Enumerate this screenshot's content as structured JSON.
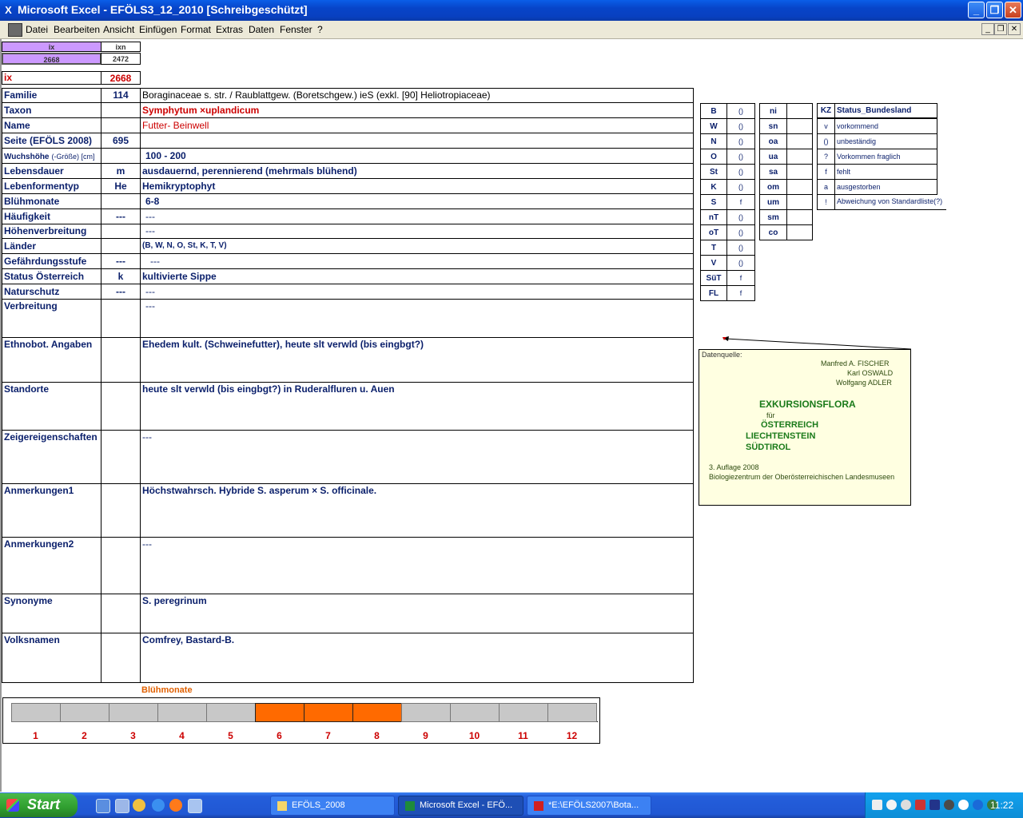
{
  "window": {
    "title": "Microsoft Excel - EFÖLS3_12_2010  [Schreibgeschützt]",
    "app_icon": "X",
    "min_label": "_",
    "max_label": "❐",
    "close_label": "✕"
  },
  "menu": [
    "Datei",
    "Bearbeiten",
    "Ansicht",
    "Einfügen",
    "Format",
    "Extras",
    "Daten",
    "Fenster",
    "?"
  ],
  "index": {
    "ix_header": "ix",
    "ixn_header": "ixn",
    "ix_value": "2668",
    "ixn_value": "2472",
    "ix_label": "ix",
    "ix_value2": "2668"
  },
  "rows": [
    {
      "label": "Familie",
      "code": "114",
      "value": "Boraginaceae s. str.  /  Raublattgew. (Boretschgew.) ieS (exkl. [90] Heliotropiaceae)"
    },
    {
      "label": "Taxon",
      "code": "",
      "value": "Symphytum ×uplandicum"
    },
    {
      "label": "Name",
      "code": "",
      "value": "Futter- Beinwell"
    },
    {
      "label": "Seite (EFÖLS 2008)",
      "code": "695",
      "value": ""
    },
    {
      "label": "Wuchshöhe",
      "label_suffix": "(-Größe) [cm]",
      "code": "",
      "value": "100 - 200"
    },
    {
      "label": "Lebensdauer",
      "code": "m",
      "value": "ausdauernd, perennierend (mehrmals blühend)"
    },
    {
      "label": "Lebenformentyp",
      "code": "He",
      "value": "Hemikryptophyt"
    },
    {
      "label": "Blühmonate",
      "code": "",
      "value": "6-8"
    },
    {
      "label": "Häufigkeit",
      "code": "---",
      "value": "---"
    },
    {
      "label": "Höhenverbreitung",
      "code": "",
      "value": "---"
    },
    {
      "label": "Länder",
      "code": "",
      "value": "(B, W, N, O, St, K, T, V)"
    },
    {
      "label": "Gefährdungsstufe",
      "code": "---",
      "value": "---"
    },
    {
      "label": "Status Österreich",
      "code": "k",
      "value": "kultivierte Sippe"
    },
    {
      "label": "Naturschutz",
      "code": "---",
      "value": "---"
    },
    {
      "label": "Verbreitung",
      "code": "",
      "value": "---"
    },
    {
      "label": "Ethnobot. Angaben",
      "code": "",
      "value": "Ehedem kult. (Schweinefutter), heute slt verwld (bis eingbgt?)"
    },
    {
      "label": "Standorte",
      "code": "",
      "value": "heute slt verwld (bis eingbgt?) in Ruderalfluren u. Auen"
    },
    {
      "label": "Zeigereigenschaften",
      "code": "",
      "value": "---"
    },
    {
      "label": "Anmerkungen1",
      "code": "",
      "value": "Höchstwahrsch. Hybride S. asperum × S. officinale."
    },
    {
      "label": "Anmerkungen2",
      "code": "",
      "value": "---"
    },
    {
      "label": "Synonyme",
      "code": "",
      "value": "S. peregrinum"
    },
    {
      "label": "Volksnamen",
      "code": "",
      "value": "Comfrey, Bastard-B."
    }
  ],
  "states": [
    {
      "code": "B",
      "status": "()"
    },
    {
      "code": "W",
      "status": "()"
    },
    {
      "code": "N",
      "status": "()"
    },
    {
      "code": "O",
      "status": "()"
    },
    {
      "code": "St",
      "status": "()"
    },
    {
      "code": "K",
      "status": "()"
    },
    {
      "code": "S",
      "status": "f"
    },
    {
      "code": "nT",
      "status": "()"
    },
    {
      "code": "oT",
      "status": "()"
    },
    {
      "code": "T",
      "status": "()"
    },
    {
      "code": "V",
      "status": "()"
    },
    {
      "code": "SüT",
      "status": "f"
    },
    {
      "code": "FL",
      "status": "f"
    }
  ],
  "altitudes": [
    "ni",
    "sn",
    "oa",
    "ua",
    "sa",
    "om",
    "um",
    "sm",
    "co"
  ],
  "legend": {
    "kz_header": "KZ",
    "status_header": "Status_Bundesland",
    "items": [
      {
        "kz": "v",
        "text": "vorkommend"
      },
      {
        "kz": "()",
        "text": "unbeständig"
      },
      {
        "kz": "?",
        "text": "Vorkommen fraglich"
      },
      {
        "kz": "f",
        "text": "fehlt"
      },
      {
        "kz": "a",
        "text": "ausgestorben"
      },
      {
        "kz": "!",
        "text": "Abweichung von Standardliste(?)"
      }
    ]
  },
  "note": {
    "heading": "Datenquelle:",
    "authors": [
      "Manfred A. FISCHER",
      "Karl OSWALD",
      "Wolfgang ADLER"
    ],
    "title": "EXKURSIONSFLORA",
    "fuer": "für",
    "countries": [
      "ÖSTERREICH",
      "LIECHTENSTEIN",
      "SÜDTIROL"
    ],
    "edition": "3. Auflage 2008",
    "publisher": "Biologiezentrum der Oberösterreichischen Landesmuseen"
  },
  "chart_data": {
    "type": "bar",
    "title": "Blühmonate",
    "categories": [
      "1",
      "2",
      "3",
      "4",
      "5",
      "6",
      "7",
      "8",
      "9",
      "10",
      "11",
      "12"
    ],
    "values": [
      0,
      0,
      0,
      0,
      0,
      1,
      1,
      1,
      0,
      0,
      0,
      0
    ],
    "colors": {
      "on": "#ff6a00",
      "off": "#c8c8c8"
    }
  },
  "taskbar": {
    "start": "Start",
    "buttons": [
      "EFÖLS_2008",
      "Microsoft Excel - EFÖ...",
      "*E:\\EFÖLS2007\\Bota..."
    ],
    "clock": "11:22"
  }
}
